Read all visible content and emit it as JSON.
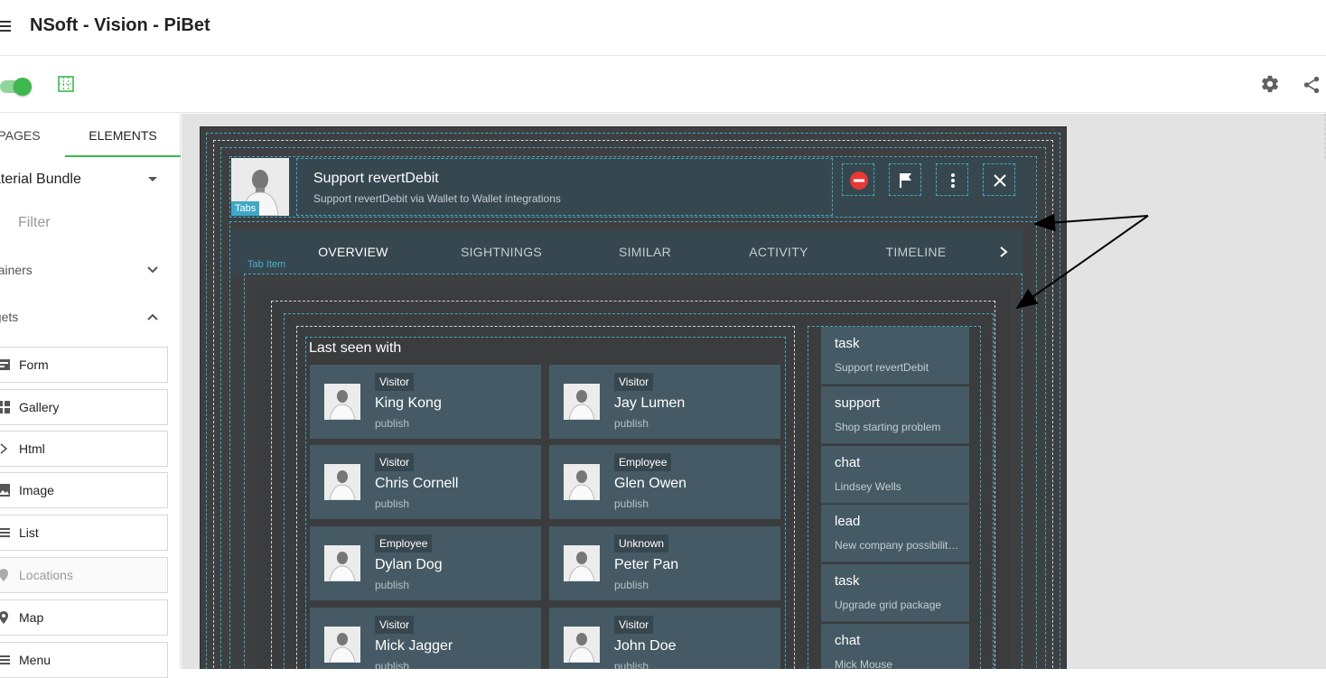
{
  "app": {
    "title": "NSoft - Vision - PiBet"
  },
  "toolbar": {
    "preview_toggle": "on",
    "icons": [
      "grid-icon",
      "gear-icon",
      "share-icon"
    ]
  },
  "left_panel": {
    "tabs": [
      {
        "label": "PAGES"
      },
      {
        "label": "ELEMENTS"
      }
    ],
    "bundle": "aterial Bundle",
    "filter_placeholder": "Filter",
    "sections": [
      {
        "label": "ntainers"
      },
      {
        "label": "dgets"
      }
    ],
    "widgets": [
      {
        "label": "Form",
        "icon": "form-icon"
      },
      {
        "label": "Gallery",
        "icon": "gallery-icon"
      },
      {
        "label": "Html",
        "icon": "html-icon"
      },
      {
        "label": "Image",
        "icon": "image-icon"
      },
      {
        "label": "List",
        "icon": "list-icon"
      },
      {
        "label": "Locations",
        "icon": "location-icon"
      },
      {
        "label": "Map",
        "icon": "map-icon"
      },
      {
        "label": "Menu",
        "icon": "menu-icon"
      }
    ]
  },
  "preview": {
    "tags": {
      "tabs": "Tabs",
      "tab_item": "Tab Item"
    },
    "header": {
      "title": "Support revertDebit",
      "subtitle": "Support revertDebit via Wallet to Wallet integrations"
    },
    "tabs": [
      {
        "label": "OVERVIEW"
      },
      {
        "label": "SIGHTNINGS"
      },
      {
        "label": "SIMILAR"
      },
      {
        "label": "ACTIVITY"
      },
      {
        "label": "TIMELINE"
      }
    ],
    "last_seen_title": "Last seen with",
    "people": [
      {
        "type": "Visitor",
        "name": "King Kong",
        "status": "publish"
      },
      {
        "type": "Visitor",
        "name": "Jay Lumen",
        "status": "publish"
      },
      {
        "type": "Visitor",
        "name": "Chris Cornell",
        "status": "publish"
      },
      {
        "type": "Employee",
        "name": "Glen Owen",
        "status": "publish"
      },
      {
        "type": "Employee",
        "name": "Dylan Dog",
        "status": "publish"
      },
      {
        "type": "Unknown",
        "name": "Peter Pan",
        "status": "publish"
      },
      {
        "type": "Visitor",
        "name": "Mick Jagger",
        "status": "publish"
      },
      {
        "type": "Visitor",
        "name": "John Doe",
        "status": "publish"
      }
    ],
    "side_items": [
      {
        "title": "task",
        "sub": "Support revertDebit"
      },
      {
        "title": "support",
        "sub": "Shop starting problem"
      },
      {
        "title": "chat",
        "sub": "Lindsey Wells"
      },
      {
        "title": "lead",
        "sub": "New company possibilities"
      },
      {
        "title": "task",
        "sub": "Upgrade grid package"
      },
      {
        "title": "chat",
        "sub": "Mick Mouse"
      }
    ]
  },
  "colors": {
    "accent": "#3cb84e",
    "panel": "#37474f",
    "card": "#455a64",
    "outline": "#44a8c3",
    "danger": "#e53935"
  }
}
